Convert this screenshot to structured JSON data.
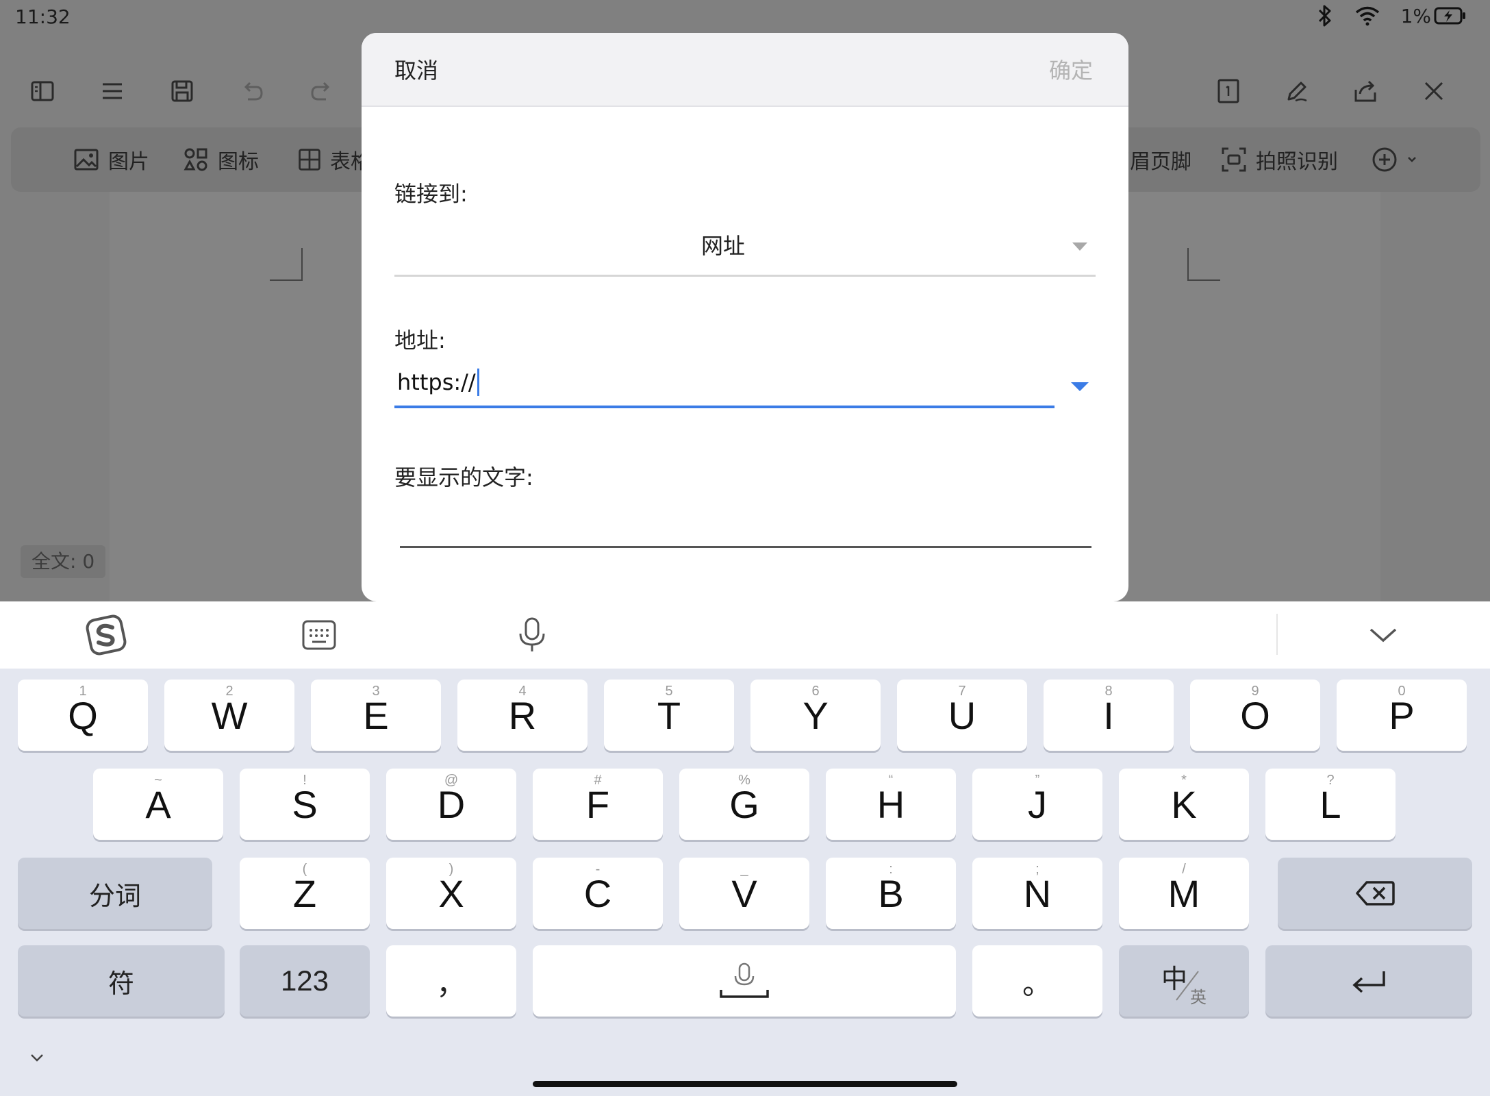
{
  "status_bar": {
    "time": "11:32",
    "battery": "1%"
  },
  "ribbon": {
    "items": [
      {
        "label": "图片",
        "icon": "image-icon"
      },
      {
        "label": "图标",
        "icon": "shapes-icon"
      },
      {
        "label": "表格",
        "icon": "table-icon"
      },
      {
        "label": "页眉页脚",
        "icon": "header-footer-icon"
      },
      {
        "label": "拍照识别",
        "icon": "scan-icon"
      }
    ]
  },
  "document": {
    "word_count": "全文: 0"
  },
  "dialog": {
    "cancel": "取消",
    "confirm": "确定",
    "link_to_label": "链接到:",
    "link_to_value": "网址",
    "address_label": "地址:",
    "address_value": "https://",
    "display_text_label": "要显示的文字:",
    "display_text_value": ""
  },
  "keyboard": {
    "row1": [
      {
        "sub": "1",
        "main": "Q"
      },
      {
        "sub": "2",
        "main": "W"
      },
      {
        "sub": "3",
        "main": "E"
      },
      {
        "sub": "4",
        "main": "R"
      },
      {
        "sub": "5",
        "main": "T"
      },
      {
        "sub": "6",
        "main": "Y"
      },
      {
        "sub": "7",
        "main": "U"
      },
      {
        "sub": "8",
        "main": "I"
      },
      {
        "sub": "9",
        "main": "O"
      },
      {
        "sub": "0",
        "main": "P"
      }
    ],
    "row2": [
      {
        "sub": "~",
        "main": "A"
      },
      {
        "sub": "!",
        "main": "S"
      },
      {
        "sub": "@",
        "main": "D"
      },
      {
        "sub": "#",
        "main": "F"
      },
      {
        "sub": "%",
        "main": "G"
      },
      {
        "sub": "“",
        "main": "H"
      },
      {
        "sub": "”",
        "main": "J"
      },
      {
        "sub": "*",
        "main": "K"
      },
      {
        "sub": "?",
        "main": "L"
      }
    ],
    "row3": [
      {
        "sub": "(",
        "main": "Z"
      },
      {
        "sub": ")",
        "main": "X"
      },
      {
        "sub": "-",
        "main": "C"
      },
      {
        "sub": "_",
        "main": "V"
      },
      {
        "sub": ":",
        "main": "B"
      },
      {
        "sub": ";",
        "main": "N"
      },
      {
        "sub": "/",
        "main": "M"
      }
    ],
    "segment_key": "分词",
    "symbol_key": "符",
    "number_key": "123",
    "comma_key": "，",
    "period_key": "。",
    "lang_key_main": "中",
    "lang_key_sub": "英"
  }
}
